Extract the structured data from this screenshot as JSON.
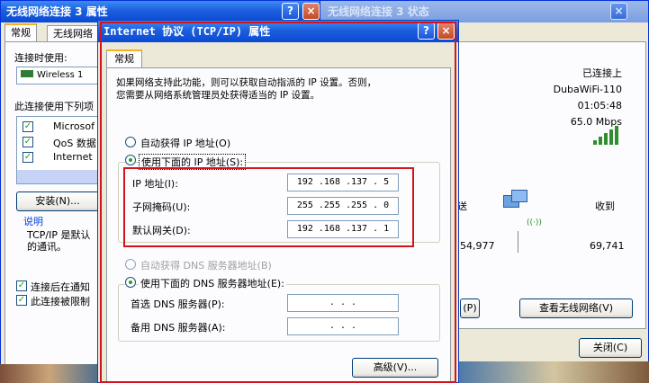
{
  "props_window": {
    "title": "无线网络连接 3 属性",
    "tabs": [
      "常规",
      "无线网络"
    ],
    "connect_using_label": "连接时使用:",
    "adapter_text": "Wireless 1",
    "uses_items_label": "此连接使用下列项",
    "items": [
      "Microsof",
      "QoS 数据",
      "Internet"
    ],
    "install_button": "安装(N)...",
    "description_title": "说明",
    "description_text": "TCP/IP 是默认\n的通讯。",
    "notify_label": "连接后在通知",
    "limited_label": "此连接被限制"
  },
  "status_window": {
    "title": "无线网络连接 3 状态",
    "status": "已连接上",
    "ssid": "DubaWiFi-110",
    "duration": "01:05:48",
    "speed": "65.0 Mbps",
    "sent_label": "送",
    "received_label": "收到",
    "sent_value": "54,977",
    "received_value": "69,741",
    "properties_button": "(P)",
    "view_wireless_button": "查看无线网络(V)",
    "close_button": "关闭(C)"
  },
  "tcpip_dialog": {
    "title": "Internet 协议 (TCP/IP) 属性",
    "help_button": "?",
    "close_button": "×",
    "tab": "常规",
    "intro_text": "如果网络支持此功能，则可以获取自动指派的 IP 设置。否则，\n您需要从网络系统管理员处获得适当的 IP 设置。",
    "auto_ip_label": "自动获得 IP 地址(O)",
    "manual_ip_label": "使用下面的 IP 地址(S):",
    "ip_label": "IP 地址(I):",
    "ip_value": "192 .168 .137 . 5",
    "mask_label": "子网掩码(U):",
    "mask_value": "255 .255 .255 . 0",
    "gateway_label": "默认网关(D):",
    "gateway_value": "192 .168 .137 . 1",
    "auto_dns_label": "自动获得 DNS 服务器地址(B)",
    "manual_dns_label": "使用下面的 DNS 服务器地址(E):",
    "preferred_dns_label": "首选 DNS 服务器(P):",
    "preferred_dns_value": " .  .  .",
    "alternate_dns_label": "备用 DNS 服务器(A):",
    "alternate_dns_value": " .  .  .",
    "advanced_button": "高级(V)...",
    "highlight_color": "#d4141c"
  }
}
